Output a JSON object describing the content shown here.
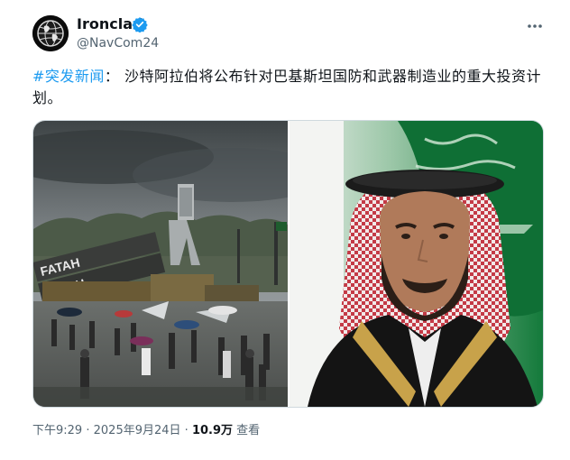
{
  "author": {
    "display_name": "Ironclad",
    "handle": "@NavCom24",
    "avatar_icon": "globe-icon",
    "verified_icon": "verified-badge-icon",
    "verified_color": "#1d9bf0"
  },
  "menu": {
    "icon": "more-icon",
    "label": "···"
  },
  "tweet": {
    "hashtag": "#突发新闻",
    "text": "： 沙特阿拉伯将公布针对巴基斯坦国防和武器制造业的重大投资计划。",
    "hashtag_color": "#1d9bf0"
  },
  "media": {
    "left_image": {
      "launcher_labels": [
        "FATAH",
        "FATAH"
      ],
      "description_icon": "military-parade-photo"
    },
    "right_image": {
      "description_icon": "portrait-photo"
    }
  },
  "meta": {
    "time": "下午9:29",
    "separator": "·",
    "date": "2025年9月24日",
    "views_count": "10.9万",
    "views_label": "查看"
  }
}
